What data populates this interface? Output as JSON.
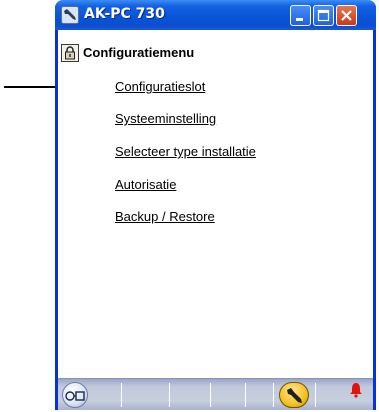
{
  "window": {
    "title": "AK-PC 730"
  },
  "menu": {
    "title": "Configuratiemenu",
    "items": [
      {
        "label": "Configuratieslot"
      },
      {
        "label": "Systeeminstelling"
      },
      {
        "label": "Selecteer type installatie"
      },
      {
        "label": "Autorisatie"
      },
      {
        "label": "Backup / Restore"
      }
    ]
  },
  "icons": {
    "app": "wrench-icon",
    "lock": "lock-icon",
    "status_left": "display-glasses-icon",
    "status_tool": "wrench-icon",
    "status_alarm": "bell-icon"
  },
  "colors": {
    "titlebar": "#0a54d8",
    "window_border": "#0831d9",
    "close_button": "#d0472a",
    "statusbar": "#c1c9dc",
    "tool_button": "#f4c21f",
    "alarm": "#e0140a"
  }
}
